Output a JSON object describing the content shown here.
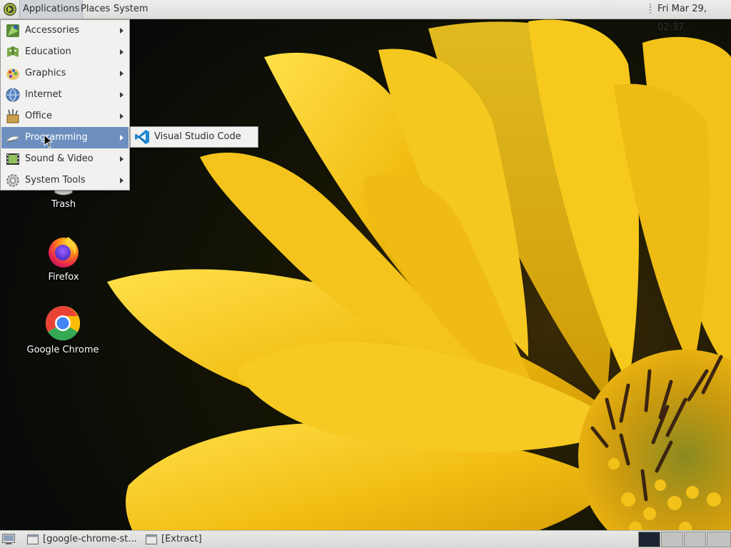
{
  "top_panel": {
    "menus": [
      "Applications",
      "Places",
      "System"
    ],
    "clock": "Fri Mar 29, 02:37"
  },
  "app_menu": {
    "items": [
      {
        "label": "Accessories",
        "icon": "accessories-icon"
      },
      {
        "label": "Education",
        "icon": "education-icon"
      },
      {
        "label": "Graphics",
        "icon": "graphics-icon"
      },
      {
        "label": "Internet",
        "icon": "internet-icon"
      },
      {
        "label": "Office",
        "icon": "office-icon"
      },
      {
        "label": "Programming",
        "icon": "programming-icon",
        "active": true
      },
      {
        "label": "Sound & Video",
        "icon": "sound-video-icon"
      },
      {
        "label": "System Tools",
        "icon": "system-tools-icon"
      }
    ],
    "submenu": {
      "parent": "Programming",
      "items": [
        {
          "label": "Visual Studio Code",
          "icon": "vscode-icon"
        }
      ]
    }
  },
  "desktop": {
    "icons": [
      {
        "label": "Trash",
        "icon": "trash-icon"
      },
      {
        "label": "Firefox",
        "icon": "firefox-icon"
      },
      {
        "label": "Google Chrome",
        "icon": "chrome-icon"
      }
    ]
  },
  "bottom_panel": {
    "tasks": [
      {
        "label": "[google-chrome-st...",
        "icon": "window-icon"
      },
      {
        "label": "[Extract]",
        "icon": "window-icon"
      }
    ],
    "workspaces": 4,
    "active_workspace": 1
  },
  "colors": {
    "menu_highlight": "#6d8fbf",
    "panel": "#e4e4e2",
    "wallpaper_petals": "#f2c21a"
  }
}
